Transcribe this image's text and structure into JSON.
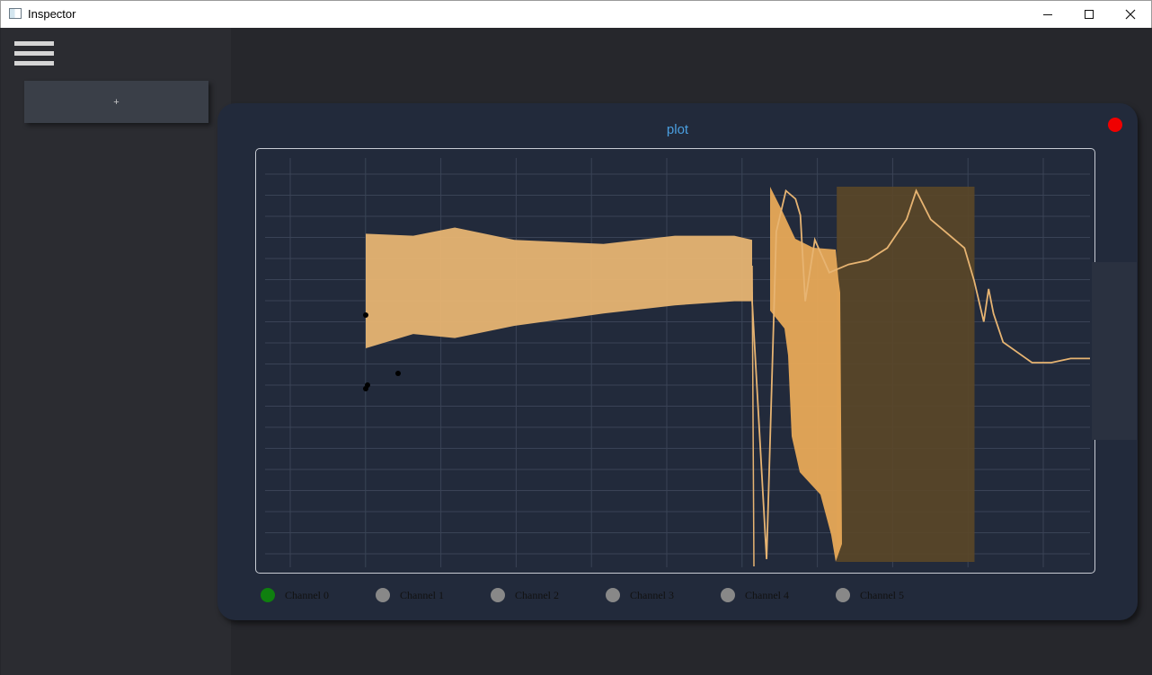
{
  "window": {
    "title": "Inspector"
  },
  "sidebar": {
    "add_label": "+"
  },
  "panel": {
    "title": "plot"
  },
  "colors": {
    "panel_bg": "#222a3b",
    "title_accent": "#4a9fe0",
    "close_dot": "#f00000",
    "signal": "#e7b472",
    "selection": "#5a4728",
    "legend_active": "#0f7f0f",
    "legend_inactive": "#888888"
  },
  "legend": [
    {
      "label": "Channel 0",
      "active": true
    },
    {
      "label": "Channel 1",
      "active": false
    },
    {
      "label": "Channel 2",
      "active": false
    },
    {
      "label": "Channel 3",
      "active": false
    },
    {
      "label": "Channel 4",
      "active": false
    },
    {
      "label": "Channel 5",
      "active": false
    }
  ],
  "chart_data": {
    "type": "line",
    "grid": true,
    "axis_labels_shown": false,
    "series": [
      {
        "envelope_upper": [
          [
            0,
            0.185
          ],
          [
            0.08,
            0.19
          ],
          [
            0.15,
            0.17
          ],
          [
            0.25,
            0.2
          ],
          [
            0.4,
            0.21
          ],
          [
            0.52,
            0.19
          ],
          [
            0.62,
            0.19
          ],
          [
            0.65,
            0.2
          ]
        ],
        "envelope_lower": [
          [
            0,
            0.465
          ],
          [
            0.08,
            0.43
          ],
          [
            0.15,
            0.44
          ],
          [
            0.25,
            0.41
          ],
          [
            0.4,
            0.38
          ],
          [
            0.52,
            0.36
          ],
          [
            0.62,
            0.35
          ],
          [
            0.65,
            0.35
          ]
        ],
        "trace": [
          [
            0.65,
            0.35
          ],
          [
            0.665,
            0.98
          ],
          [
            0.675,
            0.18
          ],
          [
            0.685,
            0.08
          ],
          [
            0.695,
            0.1
          ],
          [
            0.7,
            0.14
          ],
          [
            0.705,
            0.35
          ],
          [
            0.715,
            0.2
          ],
          [
            0.73,
            0.28
          ],
          [
            0.75,
            0.26
          ],
          [
            0.77,
            0.25
          ],
          [
            0.79,
            0.22
          ],
          [
            0.81,
            0.15
          ],
          [
            0.82,
            0.08
          ],
          [
            0.835,
            0.15
          ],
          [
            0.85,
            0.18
          ],
          [
            0.87,
            0.22
          ],
          [
            0.88,
            0.3
          ],
          [
            0.89,
            0.4
          ],
          [
            0.895,
            0.32
          ],
          [
            0.9,
            0.38
          ],
          [
            0.91,
            0.45
          ],
          [
            0.94,
            0.5
          ],
          [
            0.96,
            0.5
          ],
          [
            0.98,
            0.49
          ],
          [
            1.0,
            0.49
          ]
        ]
      }
    ],
    "selection_range_x": [
      0.693,
      0.86
    ]
  }
}
